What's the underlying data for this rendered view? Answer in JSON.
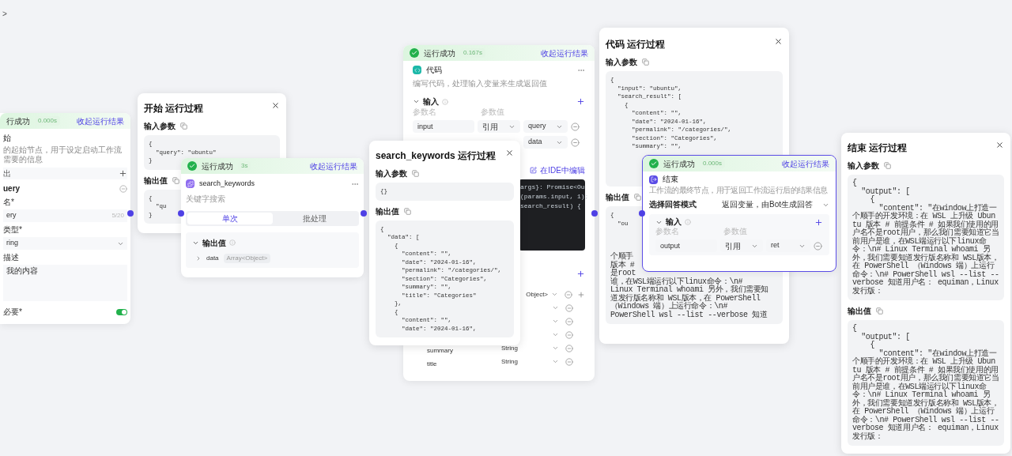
{
  "expand_toggle": ">",
  "start_node": {
    "status": "行成功",
    "time": "0.000s",
    "collapse": "收起运行结果",
    "title": "始",
    "description": "的起始节点，用于设定启动工作流需要的信息",
    "section": "出",
    "variable": "uery",
    "name_label": "名*",
    "name_value": "ery",
    "name_count": "5/20",
    "type_label": "类型*",
    "type_value": "ring",
    "desc_label": "描述",
    "desc_value": "我的内容",
    "required_label": "必要*",
    "required": true
  },
  "start_run": {
    "title": "开始 运行过程",
    "sections": [
      {
        "label": "输入参数",
        "lines": [
          "{",
          "  \"query\": \"ubuntu\"",
          "}"
        ]
      },
      {
        "label": "输出值",
        "lines": [
          "{",
          "  \"qu",
          "}"
        ]
      }
    ]
  },
  "search_node": {
    "status": "运行成功",
    "time": "3s",
    "collapse": "收起运行结果",
    "title": "search_keywords",
    "description": "关键字搜索",
    "tabs": [
      {
        "label": "单次",
        "selected": true
      },
      {
        "label": "批处理",
        "selected": false
      }
    ],
    "output_label": "输出值",
    "outputs": [
      {
        "name": "data",
        "type": "Array<Object>"
      }
    ]
  },
  "code_node": {
    "status": "运行成功",
    "time": "0.167s",
    "collapse": "收起运行结果",
    "title": "代码",
    "description": "编写代码，处理输入变量来生成返回值",
    "input_label": "输入",
    "param_headers": [
      "参数名",
      "参数值"
    ],
    "inputs": [
      {
        "name": "input",
        "mode": "引用",
        "value": "query"
      },
      {
        "value": "data"
      }
    ],
    "ide_link": "在IDE中编辑",
    "code_lines": [
      "args}: Promise<Ou",
      "(params.input, 1);",
      "search_result) {"
    ],
    "outputs": [
      {
        "type": "Object>",
        "addable": true
      },
      {
        "addable": false
      },
      {
        "addable": false
      },
      {
        "addable": false
      },
      {
        "name": "summary",
        "type": "String",
        "addable": false
      },
      {
        "name": "title",
        "type": "String",
        "addable": false
      }
    ]
  },
  "search_run": {
    "title": "search_keywords 运行过程",
    "sections": [
      {
        "label": "输入参数",
        "lines": [
          "{}"
        ]
      },
      {
        "label": "输出值",
        "lines": [
          "{",
          "  \"data\": [",
          "    {",
          "      \"content\": \"\",",
          "      \"date\": \"2024-01-16\",",
          "      \"permalink\": \"/categories/\",",
          "      \"section\": \"Categories\",",
          "      \"summary\": \"\",",
          "      \"title\": \"Categories\"",
          "    },",
          "    {",
          "      \"content\": \"\",",
          "      \"date\": \"2024-01-16\","
        ]
      }
    ]
  },
  "code_run": {
    "title": "代码 运行过程",
    "input_label": "输入参数",
    "input_lines": [
      "{",
      "  \"input\": \"ubuntu\",",
      "  \"search_result\": [",
      "    {",
      "      \"content\": \"\",",
      "      \"date\": \"2024-01-16\",",
      "      \"permalink\": \"/categories/\",",
      "      \"section\": \"Categories\",",
      "      \"summary\": \"\","
    ],
    "output_label": "输出值",
    "output_head": [
      "{",
      "  \"ou"
    ],
    "output_tail": [
      "个顺手",
      "版本 #",
      "是root",
      "谁，在WSL端运行以下linux命令：\\n#",
      "Linux Terminal whoami 另外，我们需要知",
      "道发行版名称和 WSL版本，在 PowerShell",
      "（Windows 端）上运行命令：\\n#",
      "PowerShell wsl --list --verbose 知道"
    ]
  },
  "end_node": {
    "status": "运行成功",
    "time": "0.000s",
    "collapse": "收起运行结果",
    "title": "结束",
    "description": "工作流的最终节点，用于返回工作流运行后的结果信息",
    "mode_label": "选择回答模式",
    "mode_value": "返回变量，由Bot生成回答",
    "input_label": "输入",
    "param_headers": [
      "参数名",
      "参数值"
    ],
    "inputs": [
      {
        "name": "output",
        "mode": "引用",
        "value": "ret"
      }
    ]
  },
  "end_run": {
    "title": "结束 运行过程",
    "sections": [
      {
        "label": "输入参数",
        "lines": [
          "{",
          "  \"output\": [",
          "    {",
          "      \"content\": \"在window上打造一个顺手的开发环境：在 WSL 上升级 Ubuntu 版本 # 前提条件 # 如果我们使用的用户名不是root用户，那么我们需要知道它当前用户是谁，在WSL端运行以下linux命令：\\n# Linux Terminal whoami 另外，我们需要知道发行版名称和 WSL版本，在 PowerShell （Windows 端）上运行命令：\\n# PowerShell wsl --list --verbose 知道用户名： equiman，Linux发行版："
        ]
      },
      {
        "label": "输出值",
        "lines": [
          "{",
          "  \"output\": [",
          "    {",
          "      \"content\": \"在window上打造一个顺手的开发环境：在 WSL 上升级 Ubuntu 版本 # 前提条件 # 如果我们使用的用户名不是root用户，那么我们需要知道它当前用户是谁，在WSL端运行以下linux命令：\\n# Linux Terminal whoami 另外，我们需要知道发行版名称和 WSL版本，在 PowerShell （Windows 端）上运行命令：\\n# PowerShell wsl --list --verbose 知道用户名： equiman，Linux发行版："
        ]
      }
    ]
  }
}
